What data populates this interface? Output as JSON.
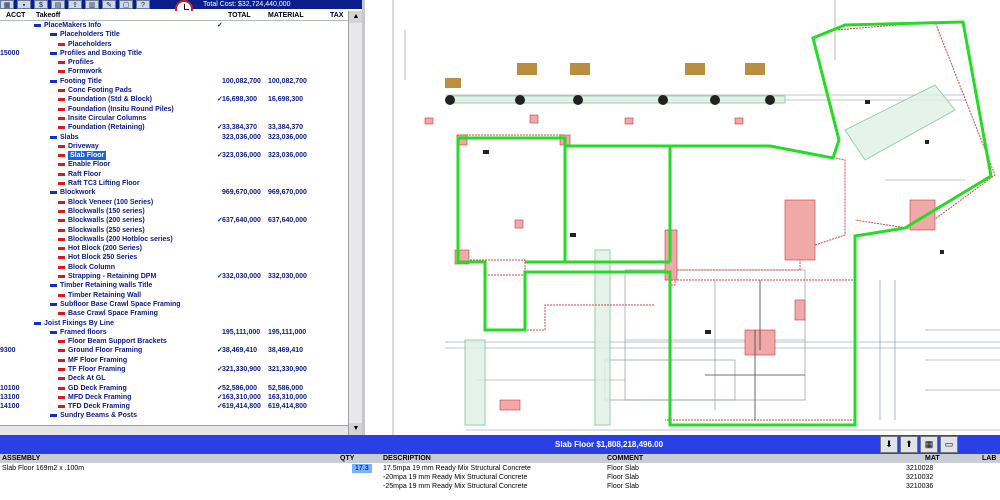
{
  "toolbar": {
    "total_cost": "Total Cost: $32,724,440,000"
  },
  "tree": {
    "columns": {
      "acct": "ACCT",
      "takeoff": "Takeoff",
      "total": "TOTAL",
      "material": "MATERIAL",
      "tax": "TAX"
    },
    "rows": [
      {
        "acct": "",
        "label": "PlaceMakers Info",
        "level": 0,
        "marker": "blue",
        "total": "",
        "material": "",
        "check": "✓"
      },
      {
        "acct": "",
        "label": "Placeholders Title",
        "level": 1,
        "marker": "blue",
        "total": "",
        "material": "",
        "check": ""
      },
      {
        "acct": "",
        "label": "Placeholders",
        "level": 2,
        "marker": "red",
        "total": "",
        "material": "",
        "check": ""
      },
      {
        "acct": "15000",
        "label": "Profiles and Boxing Title",
        "level": 1,
        "marker": "blue",
        "total": "",
        "material": "",
        "check": ""
      },
      {
        "acct": "",
        "label": "Profiles",
        "level": 2,
        "marker": "red",
        "total": "",
        "material": "",
        "check": ""
      },
      {
        "acct": "",
        "label": "Formwork",
        "level": 2,
        "marker": "red",
        "total": "",
        "material": "",
        "check": ""
      },
      {
        "acct": "",
        "label": "Footing Title",
        "level": 1,
        "marker": "blue",
        "total": "100,082,700",
        "material": "100,082,700",
        "check": ""
      },
      {
        "acct": "",
        "label": "Conc Footing Pads",
        "level": 2,
        "marker": "red",
        "total": "",
        "material": "",
        "check": ""
      },
      {
        "acct": "",
        "label": "Foundation (Std & Block)",
        "level": 2,
        "marker": "red",
        "total": "16,698,300",
        "material": "16,698,300",
        "check": "✓"
      },
      {
        "acct": "",
        "label": "Foundation (Insitu Round Piles)",
        "level": 2,
        "marker": "red",
        "total": "",
        "material": "",
        "check": ""
      },
      {
        "acct": "",
        "label": "Insite Circular Columns",
        "level": 2,
        "marker": "red",
        "total": "",
        "material": "",
        "check": ""
      },
      {
        "acct": "",
        "label": "Foundation (Retaining)",
        "level": 2,
        "marker": "red",
        "total": "33,384,370",
        "material": "33,384,370",
        "check": "✓"
      },
      {
        "acct": "",
        "label": "Slabs",
        "level": 1,
        "marker": "blue",
        "total": "323,036,000",
        "material": "323,036,000",
        "check": ""
      },
      {
        "acct": "",
        "label": "Driveway",
        "level": 2,
        "marker": "red",
        "total": "",
        "material": "",
        "check": ""
      },
      {
        "acct": "",
        "label": "Slab Floor",
        "level": 2,
        "marker": "red",
        "total": "323,036,000",
        "material": "323,036,000",
        "check": "✓",
        "selected": true
      },
      {
        "acct": "",
        "label": "Enable Floor",
        "level": 2,
        "marker": "red",
        "total": "",
        "material": "",
        "check": ""
      },
      {
        "acct": "",
        "label": "Raft Floor",
        "level": 2,
        "marker": "red",
        "total": "",
        "material": "",
        "check": ""
      },
      {
        "acct": "",
        "label": "Raft TC3 Lifting Floor",
        "level": 2,
        "marker": "red",
        "total": "",
        "material": "",
        "check": ""
      },
      {
        "acct": "",
        "label": "Blockwork",
        "level": 1,
        "marker": "blue",
        "total": "969,670,000",
        "material": "969,670,000",
        "check": ""
      },
      {
        "acct": "",
        "label": "Block Veneer (100 Series)",
        "level": 2,
        "marker": "red",
        "total": "",
        "material": "",
        "check": ""
      },
      {
        "acct": "",
        "label": "Blockwalls (150 series)",
        "level": 2,
        "marker": "red",
        "total": "",
        "material": "",
        "check": ""
      },
      {
        "acct": "",
        "label": "Blockwalls (200 series)",
        "level": 2,
        "marker": "red",
        "total": "637,640,000",
        "material": "637,640,000",
        "check": "✓"
      },
      {
        "acct": "",
        "label": "Blockwalls (250 series)",
        "level": 2,
        "marker": "red",
        "total": "",
        "material": "",
        "check": ""
      },
      {
        "acct": "",
        "label": "Blockwalls (200 Hotbloc series)",
        "level": 2,
        "marker": "red",
        "total": "",
        "material": "",
        "check": ""
      },
      {
        "acct": "",
        "label": "Hot Block (200 Series)",
        "level": 2,
        "marker": "red",
        "total": "",
        "material": "",
        "check": ""
      },
      {
        "acct": "",
        "label": "Hot Block 250 Series",
        "level": 2,
        "marker": "red",
        "total": "",
        "material": "",
        "check": ""
      },
      {
        "acct": "",
        "label": "Block Column",
        "level": 2,
        "marker": "red",
        "total": "",
        "material": "",
        "check": ""
      },
      {
        "acct": "",
        "label": "Strapping - Retaining DPM",
        "level": 2,
        "marker": "red",
        "total": "332,030,000",
        "material": "332,030,000",
        "check": "✓"
      },
      {
        "acct": "",
        "label": "Timber Retaining walls Title",
        "level": 1,
        "marker": "blue",
        "total": "",
        "material": "",
        "check": ""
      },
      {
        "acct": "",
        "label": "Timber Retaining Wall",
        "level": 2,
        "marker": "red",
        "total": "",
        "material": "",
        "check": ""
      },
      {
        "acct": "",
        "label": "Subfloor Base Crawl Space Framing",
        "level": 1,
        "marker": "blue",
        "total": "",
        "material": "",
        "check": ""
      },
      {
        "acct": "",
        "label": "Base Crawl Space Framing",
        "level": 2,
        "marker": "red",
        "total": "",
        "material": "",
        "check": ""
      },
      {
        "acct": "",
        "label": "Joist Fixings By Line",
        "level": 0,
        "marker": "blue",
        "total": "",
        "material": "",
        "check": ""
      },
      {
        "acct": "",
        "label": "Framed floors",
        "level": 1,
        "marker": "blue",
        "total": "195,111,000",
        "material": "195,111,000",
        "check": ""
      },
      {
        "acct": "",
        "label": "Floor Beam Support Brackets",
        "level": 2,
        "marker": "red",
        "total": "",
        "material": "",
        "check": ""
      },
      {
        "acct": "9300",
        "label": "Ground Floor Framing",
        "level": 2,
        "marker": "red",
        "total": "38,469,410",
        "material": "38,469,410",
        "check": "✓"
      },
      {
        "acct": "",
        "label": "MF Floor Framing",
        "level": 2,
        "marker": "red",
        "total": "",
        "material": "",
        "check": ""
      },
      {
        "acct": "",
        "label": "TF Floor Framing",
        "level": 2,
        "marker": "red",
        "total": "321,330,900",
        "material": "321,330,900",
        "check": "✓"
      },
      {
        "acct": "",
        "label": "Deck At GL",
        "level": 2,
        "marker": "red",
        "total": "",
        "material": "",
        "check": ""
      },
      {
        "acct": "10100",
        "label": "GD Deck Framing",
        "level": 2,
        "marker": "red",
        "total": "52,586,000",
        "material": "52,586,000",
        "check": "✓"
      },
      {
        "acct": "13100",
        "label": "MFD Deck Framing",
        "level": 2,
        "marker": "red",
        "total": "163,310,000",
        "material": "163,310,000",
        "check": "✓"
      },
      {
        "acct": "14100",
        "label": "TFD Deck Framing",
        "level": 2,
        "marker": "red",
        "total": "619,414,800",
        "material": "619,414,800",
        "check": "✓"
      },
      {
        "acct": "",
        "label": "Sundry Beams & Posts",
        "level": 1,
        "marker": "blue",
        "total": "",
        "material": "",
        "check": ""
      }
    ]
  },
  "status_bar": {
    "title": "Slab Floor $1,808,218,496.00"
  },
  "assembly_table": {
    "headers": {
      "assembly": "ASSEMBLY",
      "qty": "QTY",
      "description": "DESCRIPTION",
      "comment": "COMMENT",
      "mat": "MAT",
      "lab": "LAB"
    },
    "rows": [
      {
        "assembly": "Slab Floor 169m2 x .100m",
        "qty": "17.3",
        "description": "17.5mpa 19 mm Ready Mix Structural Concrete",
        "comment": "Floor Slab",
        "mat": "3210028"
      },
      {
        "assembly": "",
        "qty": "",
        "description": "-20mpa 19 mm Ready Mix Structural Concrete",
        "comment": "Floor Slab",
        "mat": "3210032"
      },
      {
        "assembly": "",
        "qty": "",
        "description": "-25mpa 19 mm Ready Mix Structural Concrete",
        "comment": "Floor Slab",
        "mat": "3210036"
      }
    ]
  },
  "colors": {
    "titlebar": "#0a1e8c",
    "status": "#2a40e6",
    "selection": "#1766e0",
    "outline": "#22dd22",
    "wall": "#e87a7a"
  }
}
